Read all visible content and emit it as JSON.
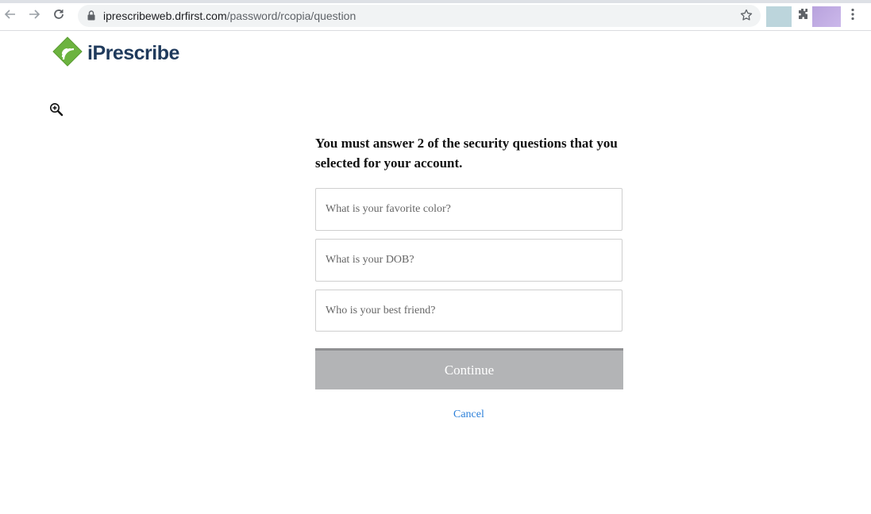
{
  "browser": {
    "url_domain": "iprescribeweb.drfirst.com",
    "url_path": "/password/rcopia/question",
    "icons": [
      "back-arrow-icon",
      "forward-arrow-icon",
      "reload-icon",
      "lock-icon",
      "star-icon",
      "puzzle-icon",
      "kebab-menu-icon"
    ]
  },
  "brand": {
    "name": "iPrescribe",
    "logo_color": "#6cb33f",
    "text_color": "#1f3a5c"
  },
  "form": {
    "heading": "You must answer 2 of the security questions that you selected for your account.",
    "questions": [
      {
        "placeholder": "What is your favorite color?",
        "value": ""
      },
      {
        "placeholder": "What is your DOB?",
        "value": ""
      },
      {
        "placeholder": "Who is your best friend?",
        "value": ""
      }
    ],
    "continue_label": "Continue",
    "cancel_label": "Cancel",
    "accent_color": "#2b7fd9",
    "button_color": "#b3b4b6"
  }
}
